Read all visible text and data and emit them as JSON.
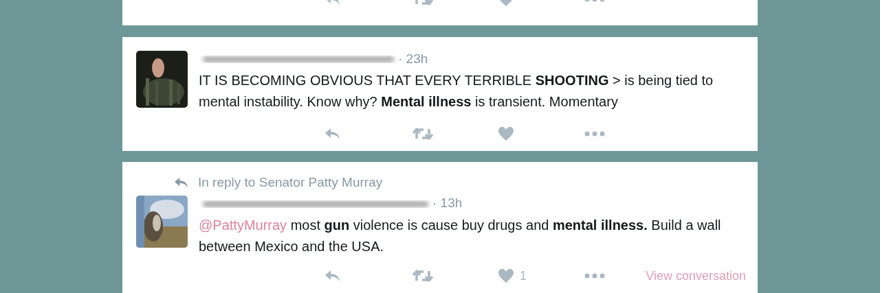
{
  "top_tweet": {
    "actions": [
      {
        "kind": "reply"
      },
      {
        "kind": "retweet"
      },
      {
        "kind": "like"
      },
      {
        "kind": "more"
      }
    ]
  },
  "tweets": [
    {
      "time": "· 23h",
      "text": "IT IS BECOMING OBVIOUS THAT EVERY TERRIBLE **SHOOTING** > is being tied to mental instability. Know why? **Mental illness** is transient. Momentary",
      "actions": [
        {
          "kind": "reply"
        },
        {
          "kind": "retweet"
        },
        {
          "kind": "like"
        },
        {
          "kind": "more"
        }
      ]
    },
    {
      "reply_to": "In reply to Senator Patty Murray",
      "time": "· 13h",
      "mention": "@PattyMurray",
      "text": " most **gun** violence is cause buy drugs and **mental illness.** Build a wall between Mexico and the USA.",
      "actions": [
        {
          "kind": "reply"
        },
        {
          "kind": "retweet"
        },
        {
          "kind": "like",
          "count": "1"
        },
        {
          "kind": "more"
        }
      ],
      "link": "View conversation"
    }
  ]
}
